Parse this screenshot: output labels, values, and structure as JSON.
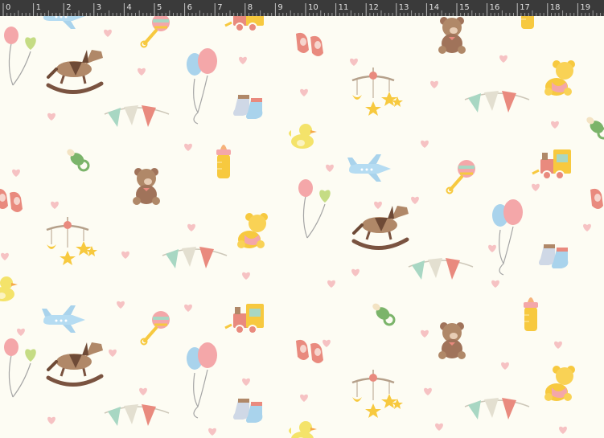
{
  "ruler": {
    "numbers": [
      "0",
      "1",
      "2",
      "3",
      "4",
      "5",
      "6",
      "7",
      "8",
      "9",
      "10",
      "11",
      "12",
      "13",
      "14",
      "15",
      "16",
      "17",
      "18",
      "19"
    ]
  },
  "canvas": {
    "background": "#fdfcf3",
    "motifs": [
      "rocking-horse-icon",
      "balloons-icon",
      "baby-socks-icon",
      "baby-mobile-icon",
      "bunting-icon",
      "teddy-bear-icon",
      "rubber-duck-icon",
      "pacifier-icon",
      "baby-bottle-icon",
      "airplane-icon",
      "rattle-icon",
      "toy-train-icon",
      "heart-balloons-icon",
      "baby-shoes-icon",
      "heart-icon"
    ]
  },
  "colors": {
    "pink": "#f4a7a9",
    "blue": "#a9d3ec",
    "mint": "#a8d7c3",
    "yellow": "#f7c93f",
    "brown": "#a0735a",
    "coral": "#e98a7e",
    "ruler_bg": "#3a3a3a",
    "ruler_text": "#e0e0e0"
  }
}
